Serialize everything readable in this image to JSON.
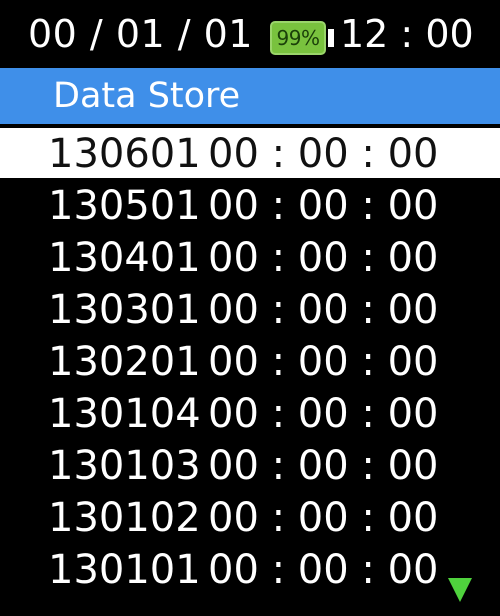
{
  "status_bar": {
    "date": "00 / 01 / 01",
    "battery_level": "99%",
    "battery_color": "#79c23e",
    "time": "12 : 00"
  },
  "title_bar": {
    "title": "Data Store",
    "color": "#3f8fe9"
  },
  "records": [
    {
      "id": "130601",
      "time": "00 : 00 : 00",
      "selected": true
    },
    {
      "id": "130501",
      "time": "00 : 00 : 00",
      "selected": false
    },
    {
      "id": "130401",
      "time": "00 : 00 : 00",
      "selected": false
    },
    {
      "id": "130301",
      "time": "00 : 00 : 00",
      "selected": false
    },
    {
      "id": "130201",
      "time": "00 : 00 : 00",
      "selected": false
    },
    {
      "id": "130104",
      "time": "00 : 00 : 00",
      "selected": false
    },
    {
      "id": "130103",
      "time": "00 : 00 : 00",
      "selected": false
    },
    {
      "id": "130102",
      "time": "00 : 00 : 00",
      "selected": false
    },
    {
      "id": "130101",
      "time": "00 : 00 : 00",
      "selected": false
    }
  ],
  "scroll_indicator": {
    "icon": "triangle-down-icon",
    "color": "#4fd23d"
  }
}
